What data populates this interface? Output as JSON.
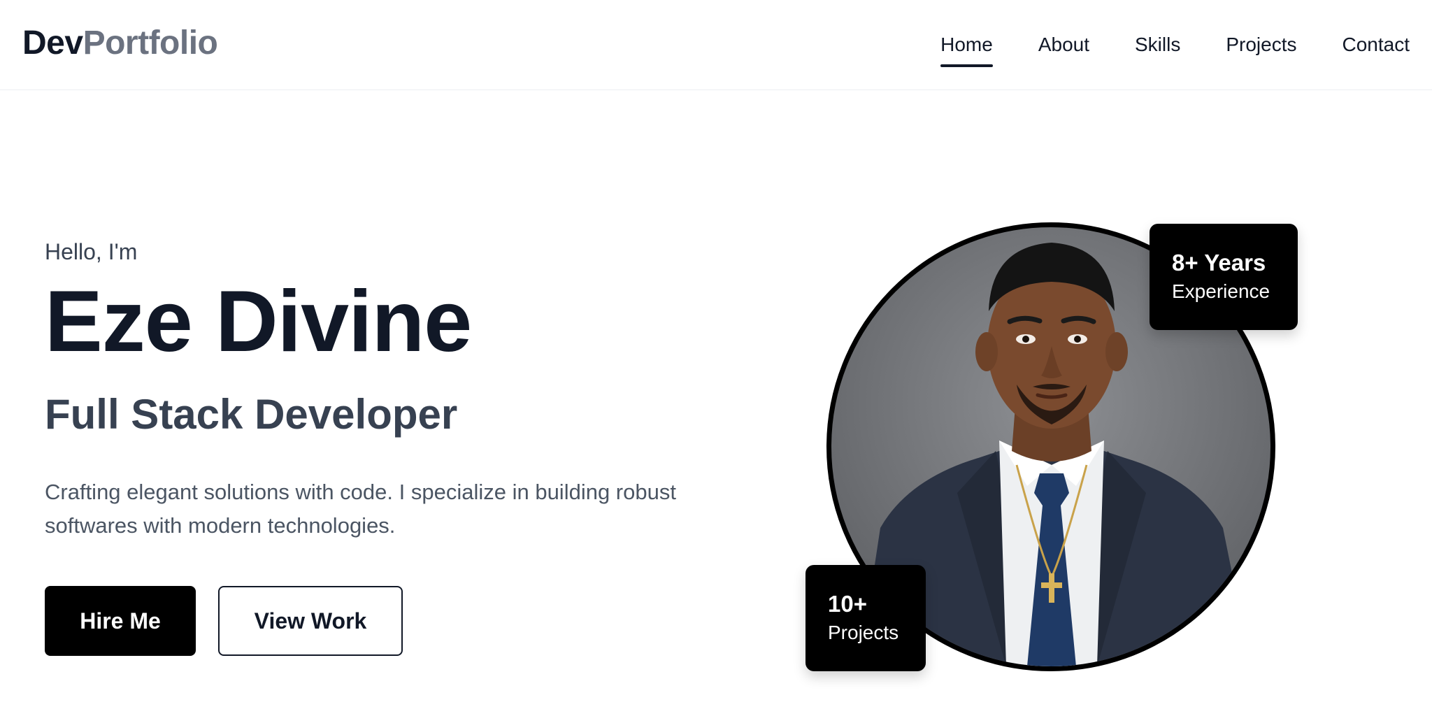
{
  "header": {
    "logo": {
      "part1": "Dev",
      "part2": "Portfolio"
    },
    "nav": [
      {
        "label": "Home",
        "active": true
      },
      {
        "label": "About"
      },
      {
        "label": "Skills"
      },
      {
        "label": "Projects"
      },
      {
        "label": "Contact"
      }
    ]
  },
  "hero": {
    "greeting": "Hello, I'm",
    "name": "Eze Divine",
    "role": "Full Stack Developer",
    "description": "Crafting elegant solutions with code. I specialize in building robust softwares with modern technologies.",
    "buttons": {
      "primary": "Hire Me",
      "secondary": "View Work"
    },
    "photo": {
      "icon": "profile-photo"
    },
    "badges": {
      "experience": {
        "value": "8+ Years",
        "label": "Experience"
      },
      "projects": {
        "value": "10+",
        "label": "Projects"
      }
    }
  },
  "colors": {
    "primary": "#000000",
    "text": "#111827",
    "muted": "#6b7280",
    "secondary_text": "#374151"
  }
}
